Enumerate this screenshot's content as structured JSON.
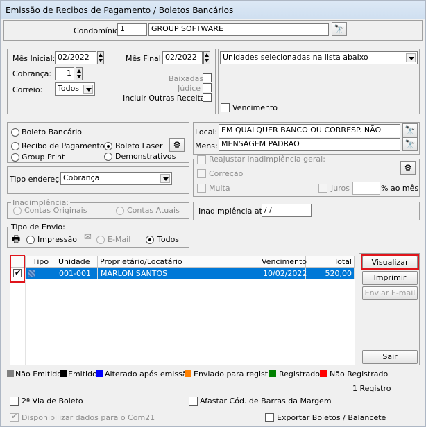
{
  "window": {
    "title": "Emissão de Recibos de Pagamento / Boletos Bancários"
  },
  "condominio": {
    "label": "Condomínio:",
    "code": "1",
    "name": "GROUP SOFTWARE"
  },
  "periodo": {
    "mes_inicial_label": "Mês Inicial:",
    "mes_inicial": "02/2022",
    "mes_final_label": "Mês Final:",
    "mes_final": "02/2022",
    "cobranca_label": "Cobrança:",
    "cobranca": "1",
    "correio_label": "Correio:",
    "correio": "Todos",
    "baixadas_label": "Baixadas",
    "judice_label": "Júdice",
    "incluir_label": "Incluir Outras Receitas"
  },
  "unidades": {
    "selected": "Unidades selecionadas na lista abaixo",
    "vencimento_label": "Vencimento"
  },
  "tipo_doc": {
    "boleto_bancario": "Boleto Bancário",
    "recibo_pagamento": "Recibo de Pagamento",
    "boleto_laser": "Boleto Laser",
    "group_print": "Group Print",
    "demonstrativos": "Demonstrativos"
  },
  "local": {
    "label": "Local:",
    "value": "EM QUALQUER BANCO OU CORRESP. NÃO"
  },
  "mens": {
    "label": "Mens:",
    "value": "MENSAGEM PADRAO"
  },
  "tipo_endereco": {
    "label": "Tipo endereço:",
    "value": "Cobrança"
  },
  "reajustar": {
    "label": "Reajustar inadimplência geral:",
    "correcao": "Correção",
    "multa": "Multa",
    "juros": "Juros",
    "ao_mes": "% ao mês"
  },
  "inadimplencia": {
    "title": "Inadimplência:",
    "contas_originais": "Contas Originais",
    "contas_atuais": "Contas Atuais"
  },
  "inadimplencia_ate": {
    "label": "Inadimplência até:",
    "value": " / /"
  },
  "envio": {
    "title": "Tipo de Envio:",
    "impressao": "Impressão",
    "email": "E-Mail",
    "todos": "Todos"
  },
  "grid": {
    "columns": [
      "Tipo",
      "Unidade",
      "Proprietário/Locatário",
      "Vencimento",
      "Total"
    ],
    "rows": [
      {
        "unidade": "001-001",
        "proprietario": "MARLON SANTOS",
        "vencimento": "10/02/2022",
        "total": "520,00"
      }
    ]
  },
  "buttons": {
    "visualizar": "Visualizar",
    "imprimir": "Imprimir",
    "enviar_email": "Enviar E-mail",
    "sair": "Sair"
  },
  "legend": [
    {
      "label": "Não Emitido",
      "color": "#808080"
    },
    {
      "label": "Emitido",
      "color": "#000000"
    },
    {
      "label": "Alterado após emissão",
      "color": "#0000ff"
    },
    {
      "label": "Enviado para registro",
      "color": "#ff8000"
    },
    {
      "label": "Registrado",
      "color": "#008000"
    },
    {
      "label": "Não Registrado",
      "color": "#ff0000"
    }
  ],
  "registro_count": "1 Registro",
  "footer": {
    "segunda_via": "2ª Via de Boleto",
    "afastar": "Afastar Cód. de Barras da Margem",
    "disponibilizar": "Disponibilizar dados para o Com21",
    "exportar": "Exportar Boletos / Balancete"
  },
  "colors": {
    "selection": "#0078d7",
    "highlight": "#e0151c"
  }
}
